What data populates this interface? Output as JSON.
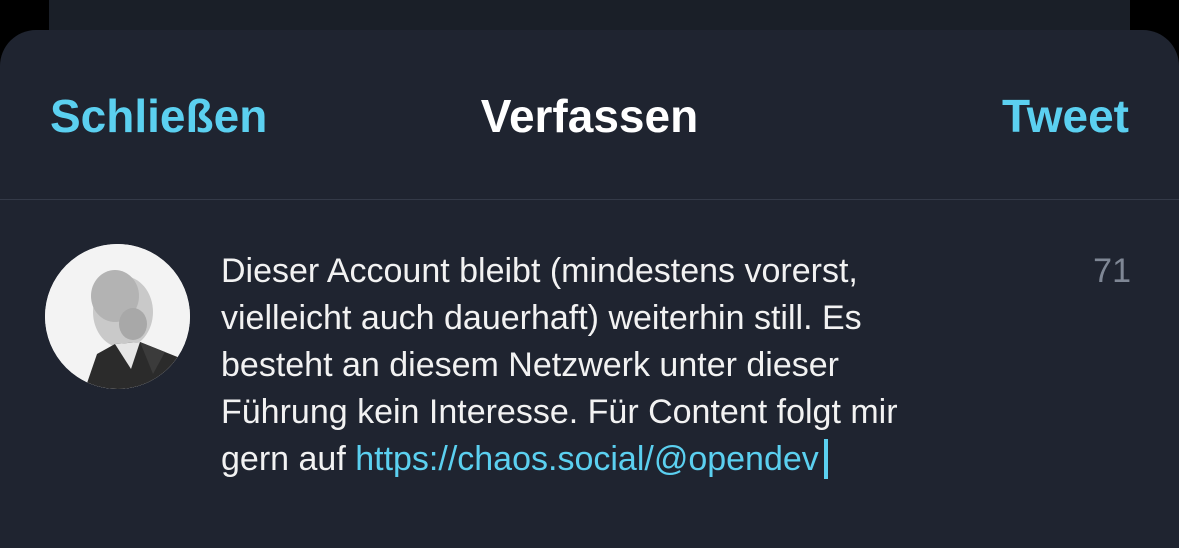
{
  "navbar": {
    "close_label": "Schließen",
    "title": "Verfassen",
    "tweet_label": "Tweet"
  },
  "composer": {
    "text": "Dieser Account bleibt (mindestens vorerst,\nvielleicht auch dauerhaft) weiterhin still. Es\nbesteht an diesem Netzwerk unter dieser\nFührung kein Interesse. Für Content folgt mir\ngern auf ",
    "link": "https://chaos.social/@opendev",
    "remaining_characters": "71"
  },
  "user": {
    "avatar_icon": "profile-photo-icon"
  },
  "colors": {
    "accent": "#5bd0f0",
    "background": "#1f2430",
    "text": "#f2f2f2",
    "muted": "#7f8795"
  }
}
